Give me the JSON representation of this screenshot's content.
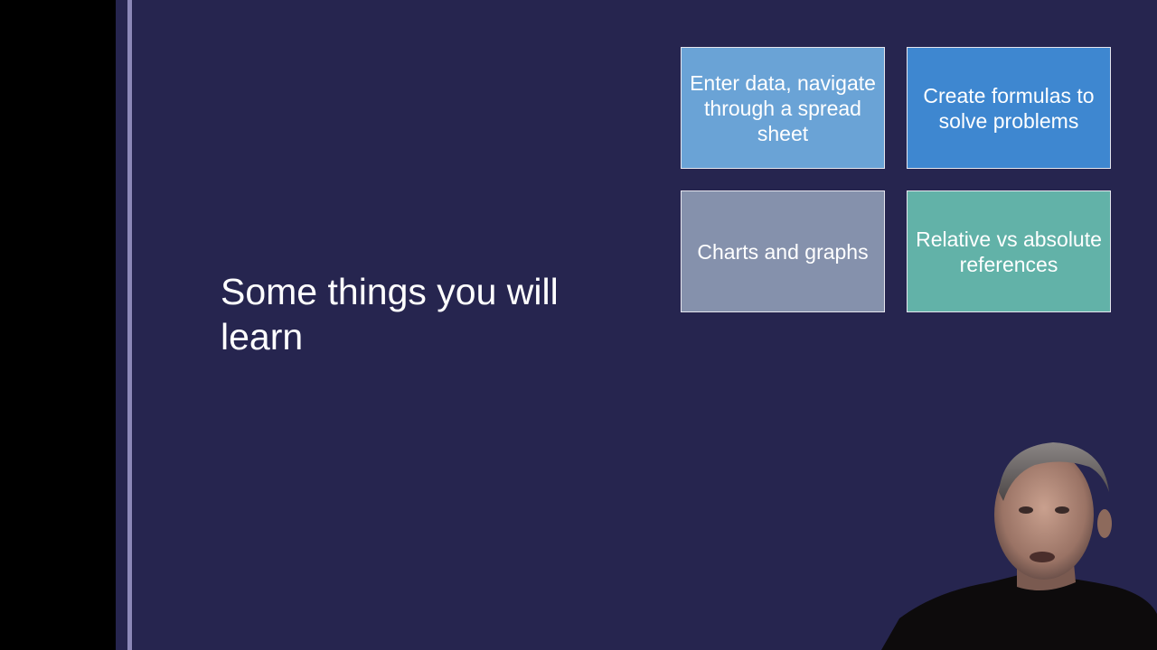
{
  "slide": {
    "title": "Some things you will learn",
    "tiles": [
      {
        "label": "Enter data, navigate through a spread sheet",
        "color": "#6aa3d6"
      },
      {
        "label": "Create formulas to solve problems",
        "color": "#3e87d0"
      },
      {
        "label": "Charts and graphs",
        "color": "#8591ac"
      },
      {
        "label": "Relative vs absolute references",
        "color": "#62b2a8"
      }
    ]
  },
  "colors": {
    "slide_background": "#26254f",
    "accent_line": "#8c88b8",
    "letterbox": "#000000"
  }
}
